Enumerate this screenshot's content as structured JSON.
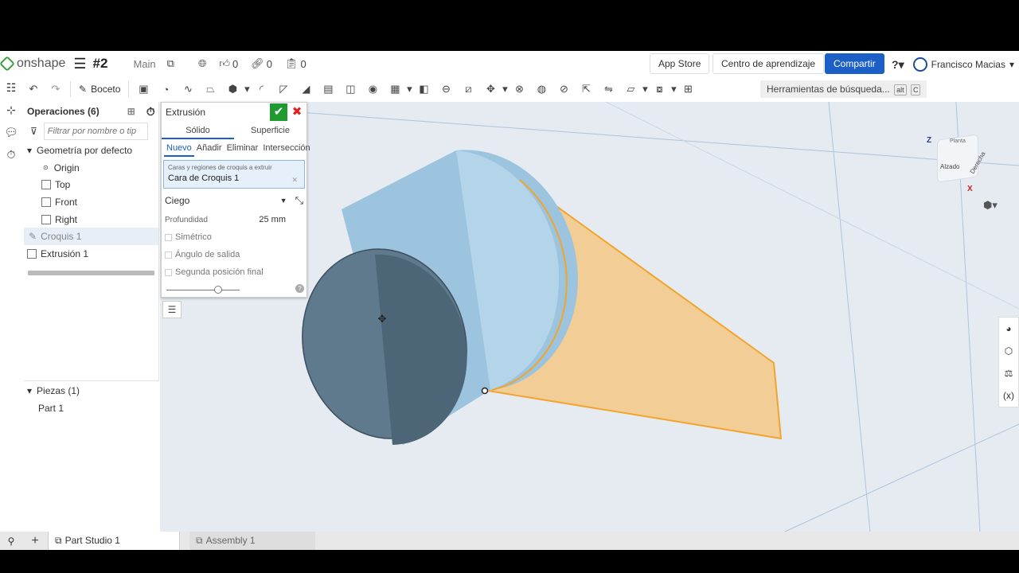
{
  "header": {
    "brand": "onshape",
    "doc_name": "#2",
    "branch": "Main",
    "likes": "0",
    "links": "0",
    "copies": "0",
    "app_store": "App Store",
    "learning": "Centro de aprendizaje",
    "share": "Compartir",
    "user": "Francisco Macias"
  },
  "toolbar": {
    "sketch": "Boceto",
    "search_tools": "Herramientas de búsqueda...",
    "kbd1": "alt",
    "kbd2": "C"
  },
  "features": {
    "title": "Operaciones (6)",
    "filter_placeholder": "Filtrar por nombre o tip",
    "default_geometry": "Geometría por defecto",
    "items": [
      "Origin",
      "Top",
      "Front",
      "Right",
      "Croquis 1",
      "Extrusión 1"
    ]
  },
  "parts": {
    "title": "Piezas (1)",
    "items": [
      "Part 1"
    ]
  },
  "dialog": {
    "title": "Extrusión",
    "tabs": [
      "Sólido",
      "Superficie"
    ],
    "subtabs": [
      "Nuevo",
      "Añadir",
      "Eliminar",
      "Intersección"
    ],
    "faces_label": "Caras y regiones de croquis a extruir",
    "faces_value": "Cara de Croquis 1",
    "end_type": "Ciego",
    "depth_label": "Profundidad",
    "depth_value": "25 mm",
    "symmetric": "Simétrico",
    "draft": "Ángulo de salida",
    "second_end": "Segunda posición final"
  },
  "viewcube": {
    "top": "Planta",
    "front": "Alzado",
    "right": "Derecha",
    "z": "Z",
    "x": "X"
  },
  "tabs": {
    "part_studio": "Part Studio 1",
    "assembly": "Assembly 1"
  },
  "colors": {
    "accent": "#1b5fc7",
    "confirm": "#1f9a2e",
    "preview": "#f5b24c",
    "body": "#8fb8d6"
  }
}
